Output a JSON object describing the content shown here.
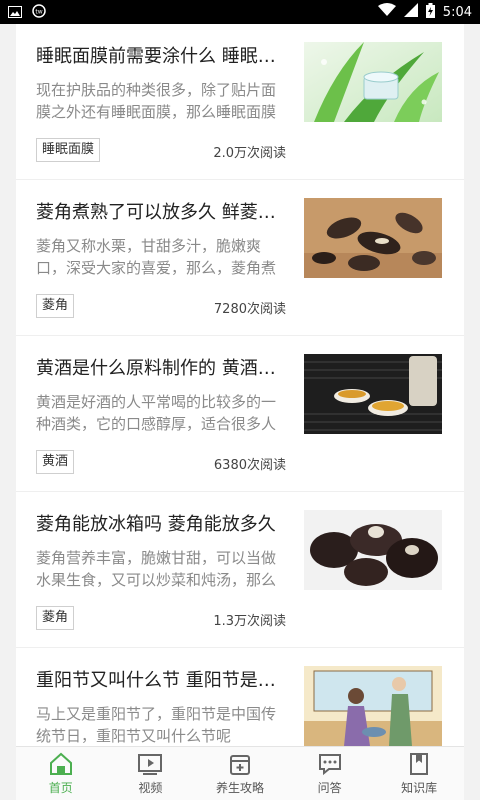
{
  "status_bar": {
    "time": "5:04",
    "icons": [
      "image-icon",
      "app-badge-icon",
      "wifi-icon",
      "signal-icon",
      "battery-charging-icon"
    ]
  },
  "articles": [
    {
      "title": "睡眠面膜前需要涂什么 睡眠面膜使用前用什么",
      "summary": "现在护肤品的种类很多，除了贴片面膜之外还有睡眠面膜，那么睡眠面膜前需要涂什么",
      "tag": "睡眠面膜",
      "reads": "2.0万次阅读",
      "image": "aloe-cream-jar"
    },
    {
      "title": "菱角煮熟了可以放多久 鲜菱角煮熟能放几天",
      "summary": "菱角又称水栗，甘甜多汁，脆嫩爽口，深受大家的喜爱，那么，菱角煮熟了可以放多久",
      "tag": "菱角",
      "reads": "7280次阅读",
      "image": "water-caltrop"
    },
    {
      "title": "黄酒是什么原料制作的 黄酒的原料有哪些",
      "summary": "黄酒是好酒的人平常喝的比较多的一种酒类，它的口感醇厚，适合很多人饮用",
      "tag": "黄酒",
      "reads": "6380次阅读",
      "image": "rice-wine-cups"
    },
    {
      "title": "菱角能放冰箱吗 菱角能放多久",
      "summary": "菱角营养丰富，脆嫩甘甜，可以当做水果生食，又可以炒菜和炖汤，那么菱角能放冰箱吗",
      "tag": "菱角",
      "reads": "1.3万次阅读",
      "image": "water-caltrop-dark"
    },
    {
      "title": "重阳节又叫什么节 重阳节是哪一天",
      "summary": "马上又是重阳节了，重阳节是中国传统节日，重阳节又叫什么节呢",
      "tag": "",
      "reads": "",
      "image": "elderly-couple-illustration"
    }
  ],
  "tabs": [
    {
      "label": "首页",
      "icon": "home-icon",
      "active": true
    },
    {
      "label": "视频",
      "icon": "video-icon",
      "active": false
    },
    {
      "label": "养生攻略",
      "icon": "guide-icon",
      "active": false
    },
    {
      "label": "问答",
      "icon": "qa-icon",
      "active": false
    },
    {
      "label": "知识库",
      "icon": "bookmark-icon",
      "active": false
    }
  ],
  "colors": {
    "accent": "#4caf50",
    "text": "#222222",
    "muted": "#8a8a8a"
  }
}
